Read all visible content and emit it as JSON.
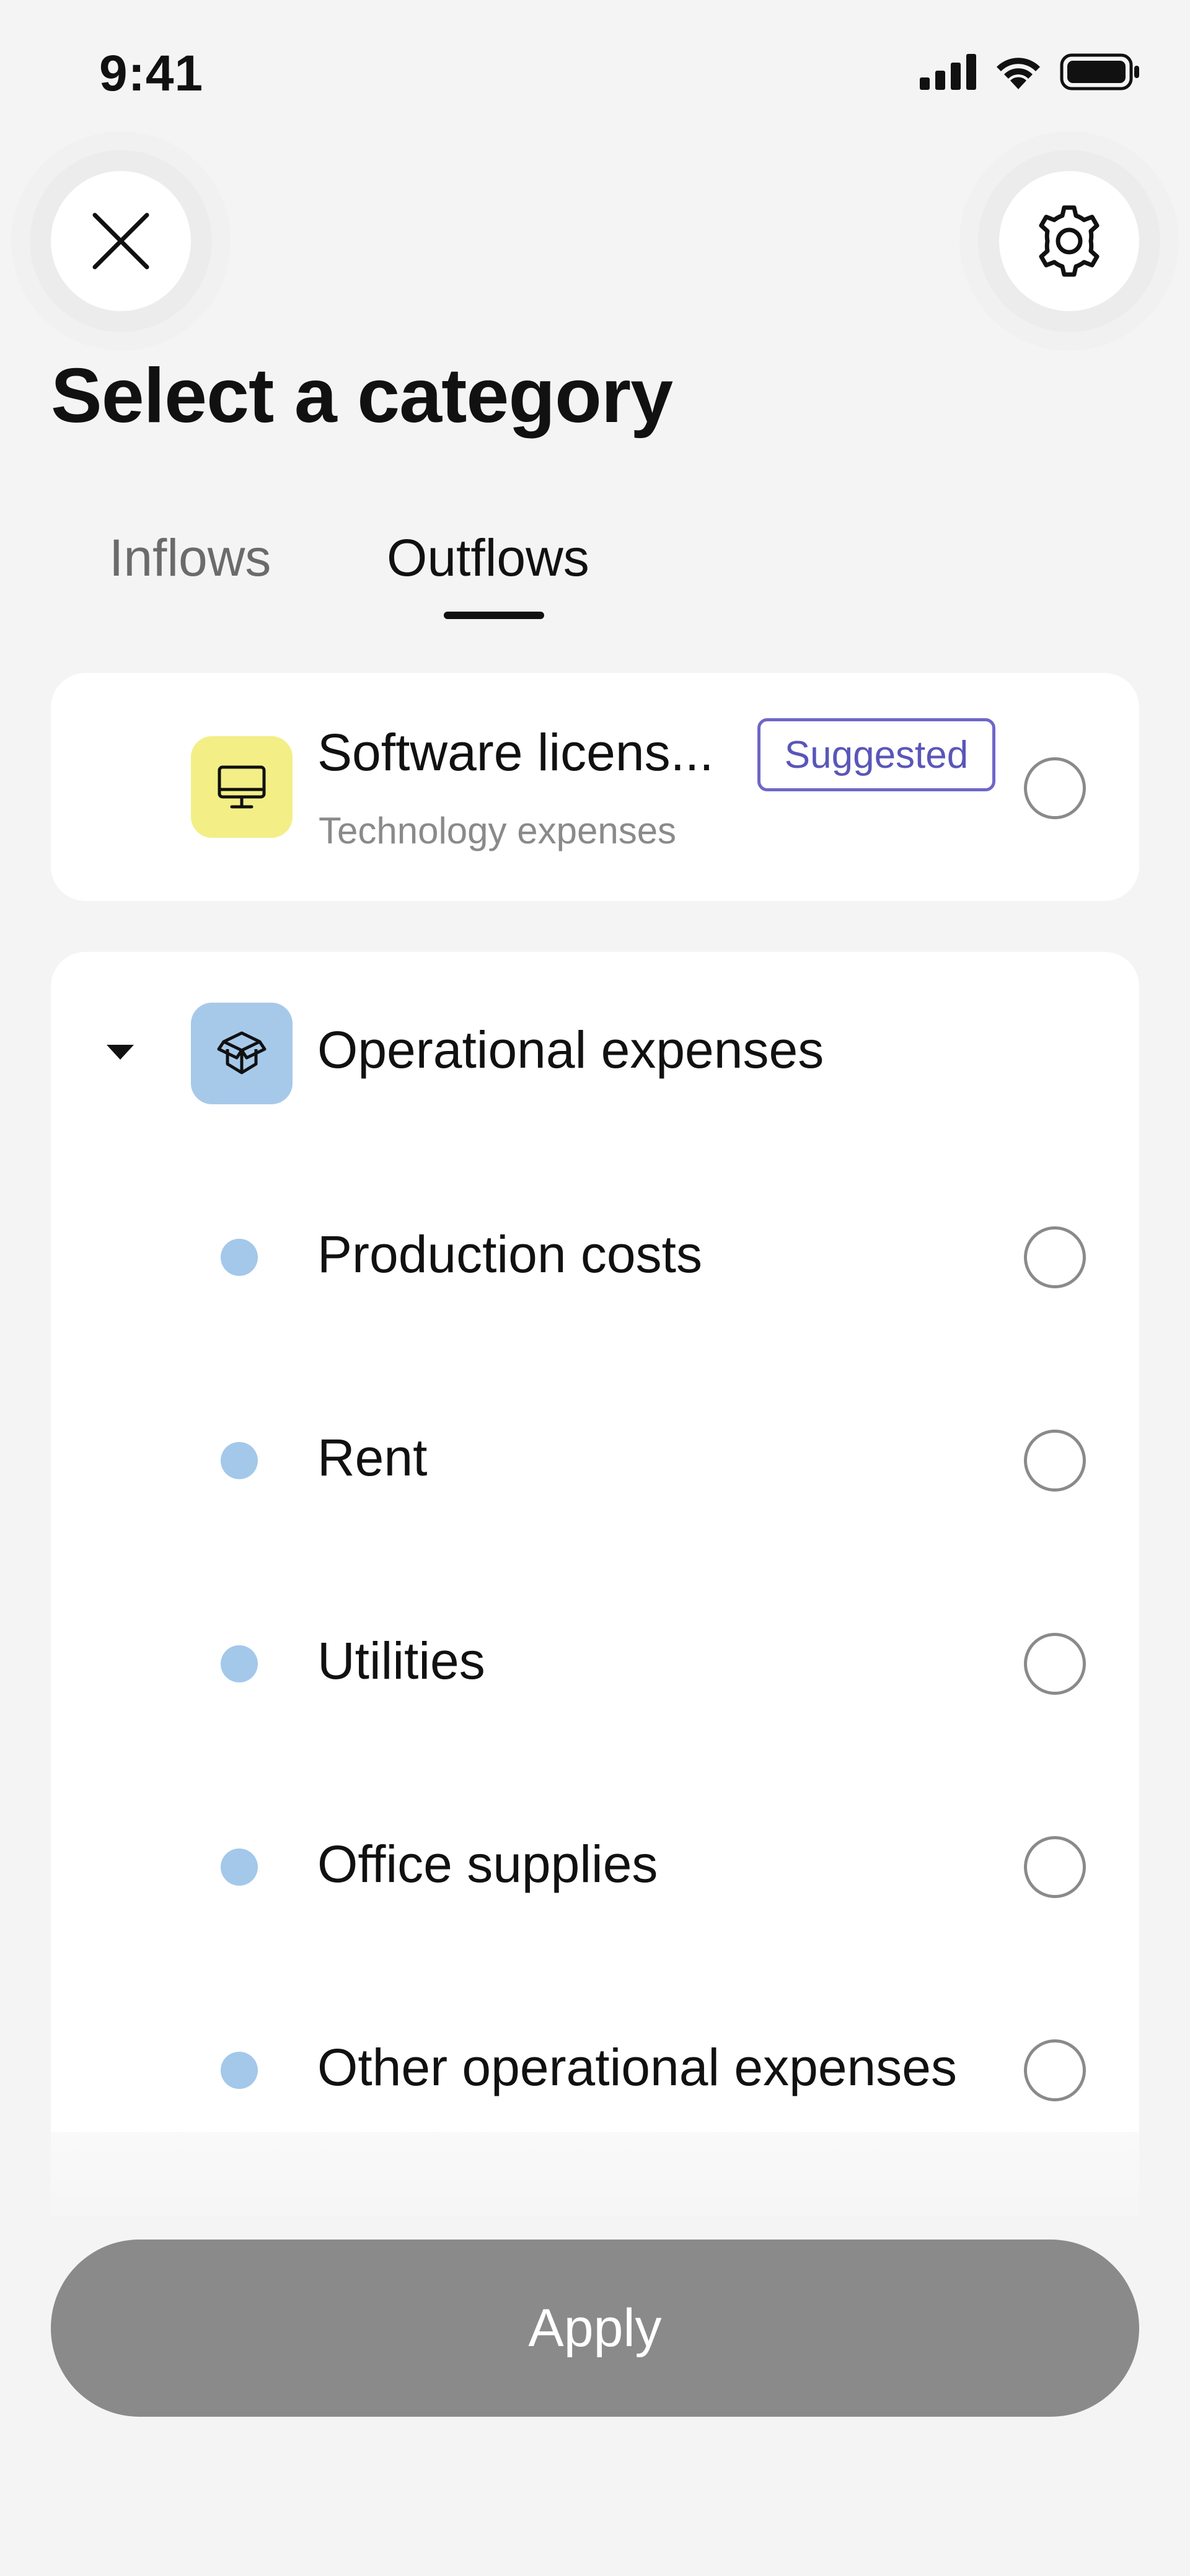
{
  "status_bar": {
    "time": "9:41"
  },
  "header": {
    "title": "Select a category"
  },
  "tabs": [
    {
      "label": "Inflows",
      "active": false
    },
    {
      "label": "Outflows",
      "active": true
    }
  ],
  "suggested": {
    "name": "Software licens...",
    "parent": "Technology expenses",
    "badge": "Suggested",
    "icon": "monitor-icon",
    "icon_bg": "#f3ef86"
  },
  "group": {
    "name": "Operational expenses",
    "icon": "box-icon",
    "icon_bg": "#a6c9ea",
    "expanded": true,
    "items": [
      {
        "label": "Production costs"
      },
      {
        "label": "Rent"
      },
      {
        "label": "Utilities"
      },
      {
        "label": "Office supplies"
      },
      {
        "label": "Other operational expenses"
      }
    ]
  },
  "footer": {
    "apply_label": "Apply"
  },
  "colors": {
    "badge_border": "#6f66c9",
    "dot": "#a3c8ea",
    "apply_bg": "#8a8a8a"
  }
}
